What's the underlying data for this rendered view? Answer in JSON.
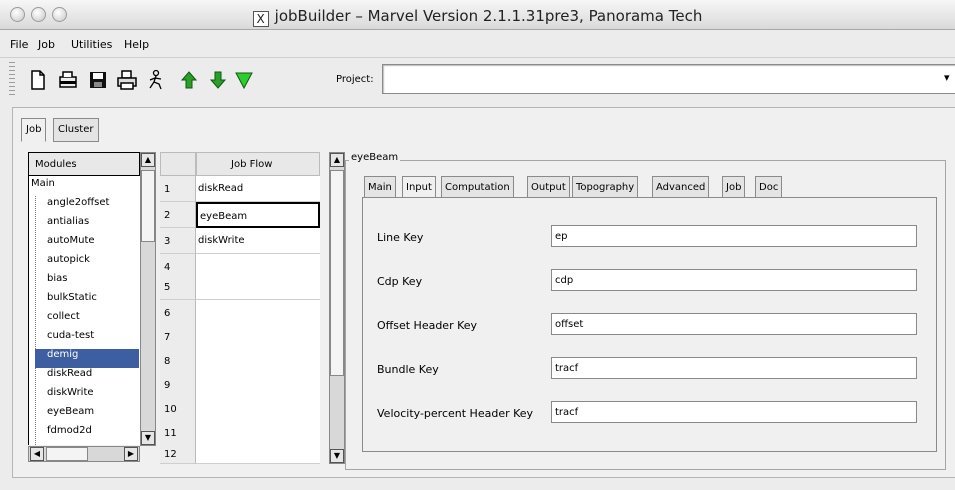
{
  "window": {
    "title": "jobBuilder – Marvel Version 2.1.1.31pre3, Panorama Tech",
    "x_logo": "X"
  },
  "menu": {
    "items": [
      "File",
      "Job",
      "Utilities",
      "Help"
    ]
  },
  "toolbar": {
    "icons": [
      "new-icon",
      "open-icon",
      "save-icon",
      "print-icon",
      "run-icon",
      "move-up-icon",
      "move-down-icon",
      "filter-icon"
    ],
    "project_label": "Project:",
    "project_value": ""
  },
  "tabs": {
    "items": [
      "Job",
      "Cluster"
    ],
    "active": "Job"
  },
  "modules": {
    "header": "Modules",
    "root": "Main",
    "items": [
      "angle2offset",
      "antialias",
      "autoMute",
      "autopick",
      "bias",
      "bulkStatic",
      "collect",
      "cuda-test",
      "demig",
      "diskRead",
      "diskWrite",
      "eyeBeam",
      "fdmod2d"
    ],
    "selected": "demig"
  },
  "job_flow": {
    "header": "Job Flow",
    "rows": [
      {
        "num": "1",
        "value": "diskRead"
      },
      {
        "num": "2",
        "value": "eyeBeam"
      },
      {
        "num": "3",
        "value": "diskWrite"
      },
      {
        "num": "4",
        "value": ""
      },
      {
        "num": "5",
        "value": ""
      },
      {
        "num": "6",
        "value": ""
      },
      {
        "num": "7",
        "value": ""
      },
      {
        "num": "8",
        "value": ""
      },
      {
        "num": "9",
        "value": ""
      },
      {
        "num": "10",
        "value": ""
      },
      {
        "num": "11",
        "value": ""
      },
      {
        "num": "12",
        "value": ""
      }
    ],
    "selected_row": "2"
  },
  "module_panel": {
    "title": "eyeBeam",
    "tabs": [
      "Main",
      "Input",
      "Computation",
      "Output",
      "Topography",
      "Advanced",
      "Job",
      "Doc"
    ],
    "active_tab": "Input",
    "fields": [
      {
        "label": "Line Key",
        "value": "ep"
      },
      {
        "label": "Cdp Key",
        "value": "cdp"
      },
      {
        "label": "Offset Header Key",
        "value": "offset"
      },
      {
        "label": "Bundle Key",
        "value": "tracf"
      },
      {
        "label": "Velocity-percent Header Key",
        "value": "tracf"
      }
    ]
  }
}
